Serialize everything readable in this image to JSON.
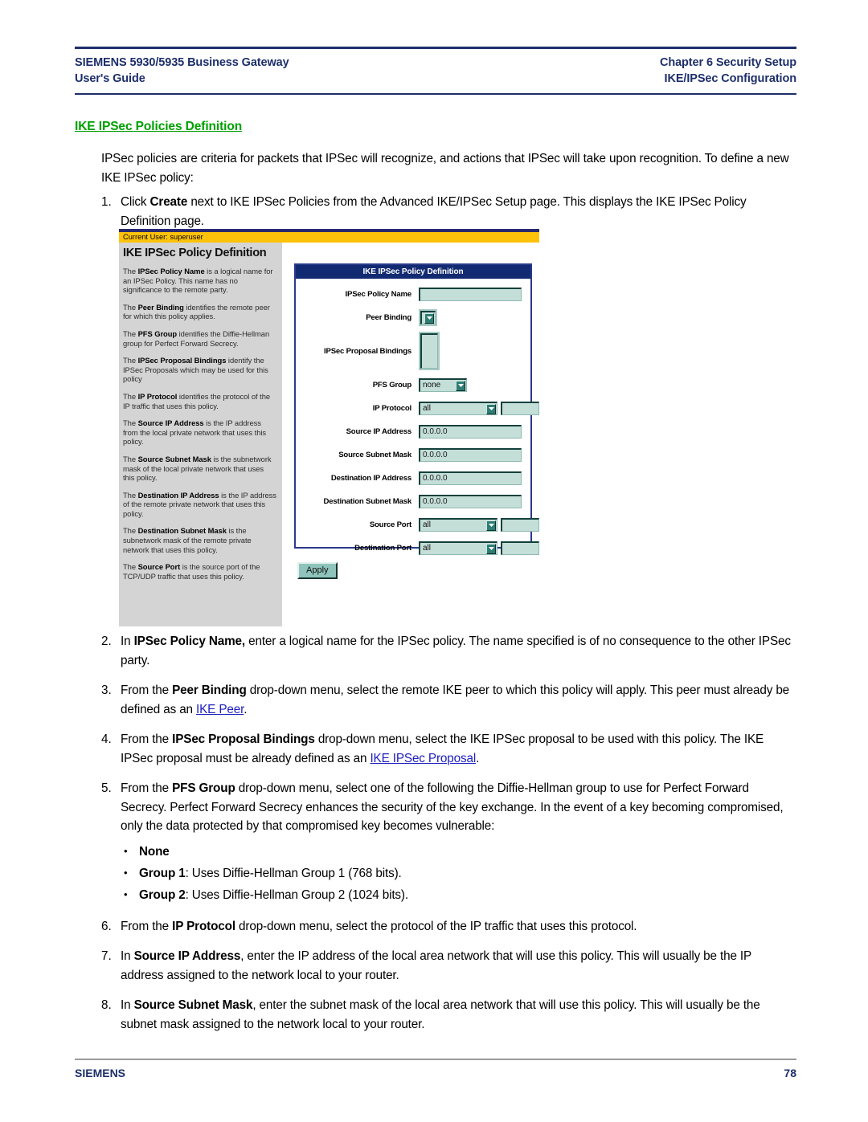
{
  "header": {
    "left_line1": "SIEMENS 5930/5935 Business Gateway",
    "left_line2": "User's Guide",
    "right_line1": "Chapter 6  Security Setup",
    "right_line2": "IKE/IPSec Configuration"
  },
  "section": {
    "heading": "IKE IPSec Policies Definition",
    "intro": "IPSec policies are criteria for packets that IPSec will recognize, and actions that IPSec will take upon recognition. To define a new IKE IPSec policy:"
  },
  "steps": {
    "s1": {
      "num": "1.",
      "a": "Click ",
      "b": "Create",
      "c": " next to IKE IPSec Policies from the Advanced IKE/IPSec Setup page. This displays the IKE IPSec Policy Definition page."
    },
    "s2": {
      "num": "2.",
      "a": "In ",
      "b": "IPSec Policy Name,",
      "c": " enter a logical name for the IPSec policy. The name specified is of no consequence to the other IPSec party."
    },
    "s3": {
      "num": "3.",
      "a": "From the ",
      "b": "Peer Binding",
      "c": " drop-down menu, select the remote IKE peer to which this policy will apply. This peer must already be defined as an ",
      "link": "IKE Peer",
      "d": "."
    },
    "s4": {
      "num": "4.",
      "a": "From the ",
      "b": "IPSec Proposal Bindings",
      "c": " drop-down menu, select the IKE IPSec proposal to be used with this policy. The IKE IPSec proposal must be already defined as an ",
      "link": "IKE IPSec Proposal",
      "d": "."
    },
    "s5": {
      "num": "5.",
      "a": "From the ",
      "b": "PFS Group",
      "c": " drop-down menu, select one of the following the Diffie-Hellman group to use for Perfect Forward Secrecy. Perfect Forward Secrecy enhances the security of the key exchange. In the event of a key becoming compromised, only the data protected by that compromised key becomes vulnerable:",
      "bullets": [
        {
          "bold": "None",
          "rest": ""
        },
        {
          "bold": "Group 1",
          "rest": ": Uses Diffie-Hellman Group 1 (768 bits)."
        },
        {
          "bold": "Group 2",
          "rest": ": Uses Diffie-Hellman Group 2 (1024 bits)."
        }
      ]
    },
    "s6": {
      "num": "6.",
      "a": "From the ",
      "b": "IP Protocol",
      "c": " drop-down menu, select the protocol of the IP traffic that uses this protocol."
    },
    "s7": {
      "num": "7.",
      "a": "In ",
      "b": "Source IP Address",
      "c": ", enter the IP address of the local area network that will use this policy. This will usually be the IP address assigned to the network local to your router."
    },
    "s8": {
      "num": "8.",
      "a": "In ",
      "b": "Source Subnet Mask",
      "c": ", enter the subnet mask of the local area network that will use this policy. This will usually be the subnet mask assigned to the network local to your router."
    }
  },
  "screenshot": {
    "user_bar": "Current User: superuser",
    "help_title": "IKE IPSec Policy Definition",
    "help_paragraphs": [
      {
        "a": "The ",
        "b": "IPSec Policy Name",
        "c": " is a logical name for an IPSec Policy. This name has no significance to the remote party."
      },
      {
        "a": "The ",
        "b": "Peer Binding",
        "c": " identifies the remote peer for which this policy applies."
      },
      {
        "a": "The ",
        "b": "PFS Group",
        "c": " identifies the Diffie-Hellman group for Perfect Forward Secrecy."
      },
      {
        "a": "The ",
        "b": "IPSec Proposal Bindings",
        "c": " identify the IPSec Proposals which may be used for this policy"
      },
      {
        "a": "The ",
        "b": "IP Protocol",
        "c": " identifies the protocol of the IP traffic that uses this policy."
      },
      {
        "a": "The ",
        "b": "Source IP Address",
        "c": " is the IP address from the local private network that uses this policy."
      },
      {
        "a": "The ",
        "b": "Source Subnet Mask",
        "c": " is the subnetwork mask of the local private network that uses this policy."
      },
      {
        "a": "The ",
        "b": "Destination IP Address",
        "c": " is the IP address of the remote private network that uses this policy."
      },
      {
        "a": "The ",
        "b": "Destination Subnet Mask",
        "c": " is the subnetwork mask of the remote private network that uses this policy."
      },
      {
        "a": "The ",
        "b": "Source Port",
        "c": " is the source port of the TCP/UDP traffic that uses this policy."
      }
    ],
    "form_title": "IKE IPSec Policy Definition",
    "fields": {
      "policy_name": {
        "label": "IPSec Policy Name",
        "value": ""
      },
      "peer_binding": {
        "label": "Peer Binding",
        "value": ""
      },
      "proposal_bindings": {
        "label": "IPSec Proposal Bindings",
        "value": ""
      },
      "pfs_group": {
        "label": "PFS Group",
        "value": "none"
      },
      "ip_protocol": {
        "label": "IP Protocol",
        "value": "all",
        "extra": ""
      },
      "source_ip": {
        "label": "Source IP Address",
        "value": "0.0.0.0"
      },
      "source_mask": {
        "label": "Source Subnet Mask",
        "value": "0.0.0.0"
      },
      "dest_ip": {
        "label": "Destination IP Address",
        "value": "0.0.0.0"
      },
      "dest_mask": {
        "label": "Destination Subnet Mask",
        "value": "0.0.0.0"
      },
      "source_port": {
        "label": "Source Port",
        "value": "all",
        "extra": ""
      },
      "dest_port": {
        "label": "Destination Port",
        "value": "all",
        "extra": ""
      }
    },
    "apply_label": "Apply"
  },
  "footer": {
    "brand": "SIEMENS",
    "page": "78"
  },
  "colors": {
    "heading_green": "#00a000",
    "navy": "#1d2f6b",
    "link_blue": "#2020c0",
    "user_bar_yellow": "#ffc20a",
    "panel_navy": "#122a72",
    "field_teal": "#c4ded8"
  }
}
